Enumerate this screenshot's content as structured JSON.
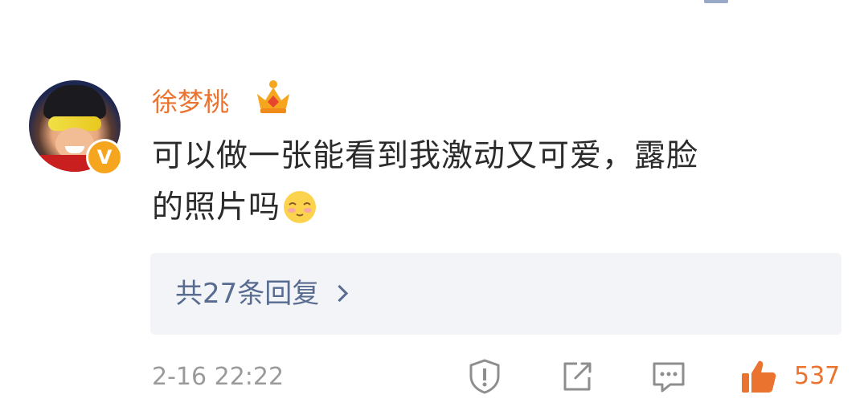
{
  "comment": {
    "username": "徐梦桃",
    "text_line1": "可以做一张能看到我激动又可爱，露脸",
    "text_line2": "的照片吗",
    "avatar_badge": "V",
    "timestamp": "2-16 22:22",
    "like_count": "537"
  },
  "replies": {
    "label": "共27条回复"
  },
  "colors": {
    "username": "#eb7330",
    "link": "#586b91",
    "like": "#eb7330",
    "badge": "#f6a51f",
    "text": "#2b2b2b",
    "meta": "#9a9a9a"
  },
  "icons": {
    "rank": "crown-icon",
    "emoji": "blush-emoji-icon",
    "report": "warning-shield-icon",
    "share": "share-icon",
    "comment": "comment-icon",
    "like": "thumbs-up-icon",
    "more": "chevron-right-icon"
  }
}
